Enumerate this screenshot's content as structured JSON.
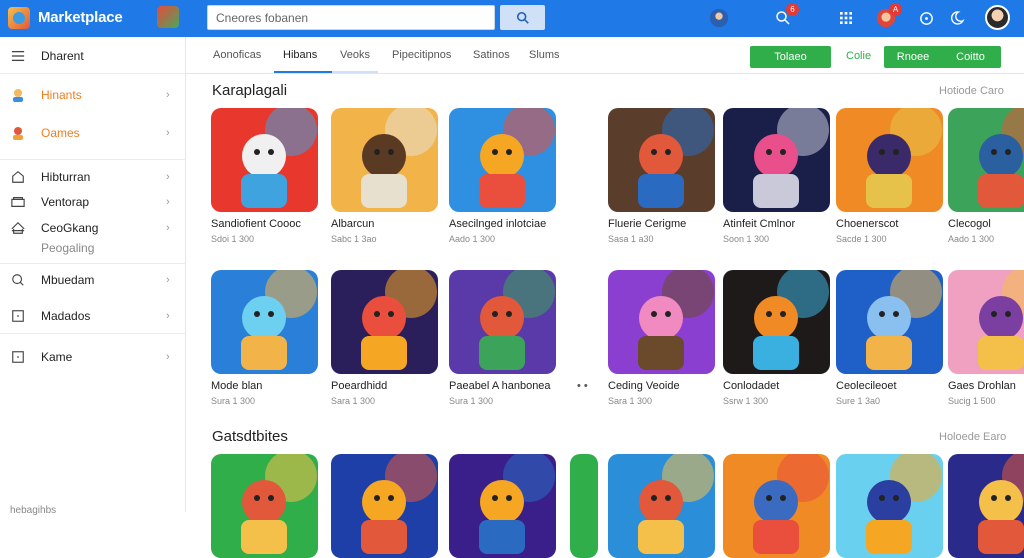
{
  "header": {
    "app_title": "Marketplace",
    "search_placeholder": "Cneores fobanen",
    "notification_count": "6",
    "alert_count": "A"
  },
  "sidebar": {
    "items": [
      {
        "label": "Dharent",
        "icon": "menu-icon"
      },
      {
        "label": "Hinants",
        "icon": "character-icon",
        "accent": true
      },
      {
        "label": "Oames",
        "icon": "game-icon",
        "accent": true
      },
      {
        "label": "Hibturran",
        "icon": "home-icon"
      },
      {
        "label": "Ventorap",
        "icon": "folder-icon"
      },
      {
        "label": "CeoGkang",
        "icon": "store-icon"
      },
      {
        "label": "Mbuedam",
        "icon": "chat-icon"
      },
      {
        "label": "Madados",
        "icon": "box-icon"
      },
      {
        "label": "Kame",
        "icon": "square-icon"
      }
    ],
    "sub_label": "Peogaling",
    "footer_label": "hebagihbs"
  },
  "tabs": [
    "Aonoficas",
    "Hibans",
    "Veoks",
    "Pipecitipnos",
    "Satinos",
    "Slums"
  ],
  "actions": {
    "green1": "Tolaeo",
    "plain": "Colie",
    "green2": "Rnoee",
    "green3": "Coitto"
  },
  "sections": [
    {
      "title": "Karaplagali",
      "link": "Hotiode Caro",
      "rows": [
        [
          {
            "name": "Sandiofient Coooc",
            "meta": "Sdoi 1 300"
          },
          {
            "name": "Albarcun",
            "meta": "Sabc 1 3ao"
          },
          {
            "name": "Asecilnged inlotciae",
            "meta": "Aado 1 300"
          },
          {
            "name": "Fluerie Cerigme",
            "meta": "Sasa 1 a30"
          },
          {
            "name": "Atinfeit Cmlnor",
            "meta": "Soon 1 300"
          },
          {
            "name": "Choenerscot",
            "meta": "Sacde 1 300"
          },
          {
            "name": "Clecogol",
            "meta": "Aado 1 300"
          }
        ],
        [
          {
            "name": "Mode blan",
            "meta": "Sura 1 300"
          },
          {
            "name": "Poeardhidd",
            "meta": "Sara 1 300"
          },
          {
            "name": "Paeabel A hanbonea",
            "meta": "Sura 1 300"
          },
          {
            "name": "Ceding Veoide",
            "meta": "Sara 1 300"
          },
          {
            "name": "Conlodadet",
            "meta": "Ssrw 1 300"
          },
          {
            "name": "Ceolecileoet",
            "meta": "Sure 1 3a0"
          },
          {
            "name": "Gaes Drohlan",
            "meta": "Sucig 1 500"
          }
        ]
      ]
    },
    {
      "title": "Gatsdtbites",
      "link": "Holoede Earo",
      "rows": [
        []
      ]
    }
  ],
  "more_glyph": "• •",
  "colors": {
    "brand_blue": "#1f7ae8",
    "action_green": "#2fae49",
    "accent_orange": "#f07d1e"
  }
}
